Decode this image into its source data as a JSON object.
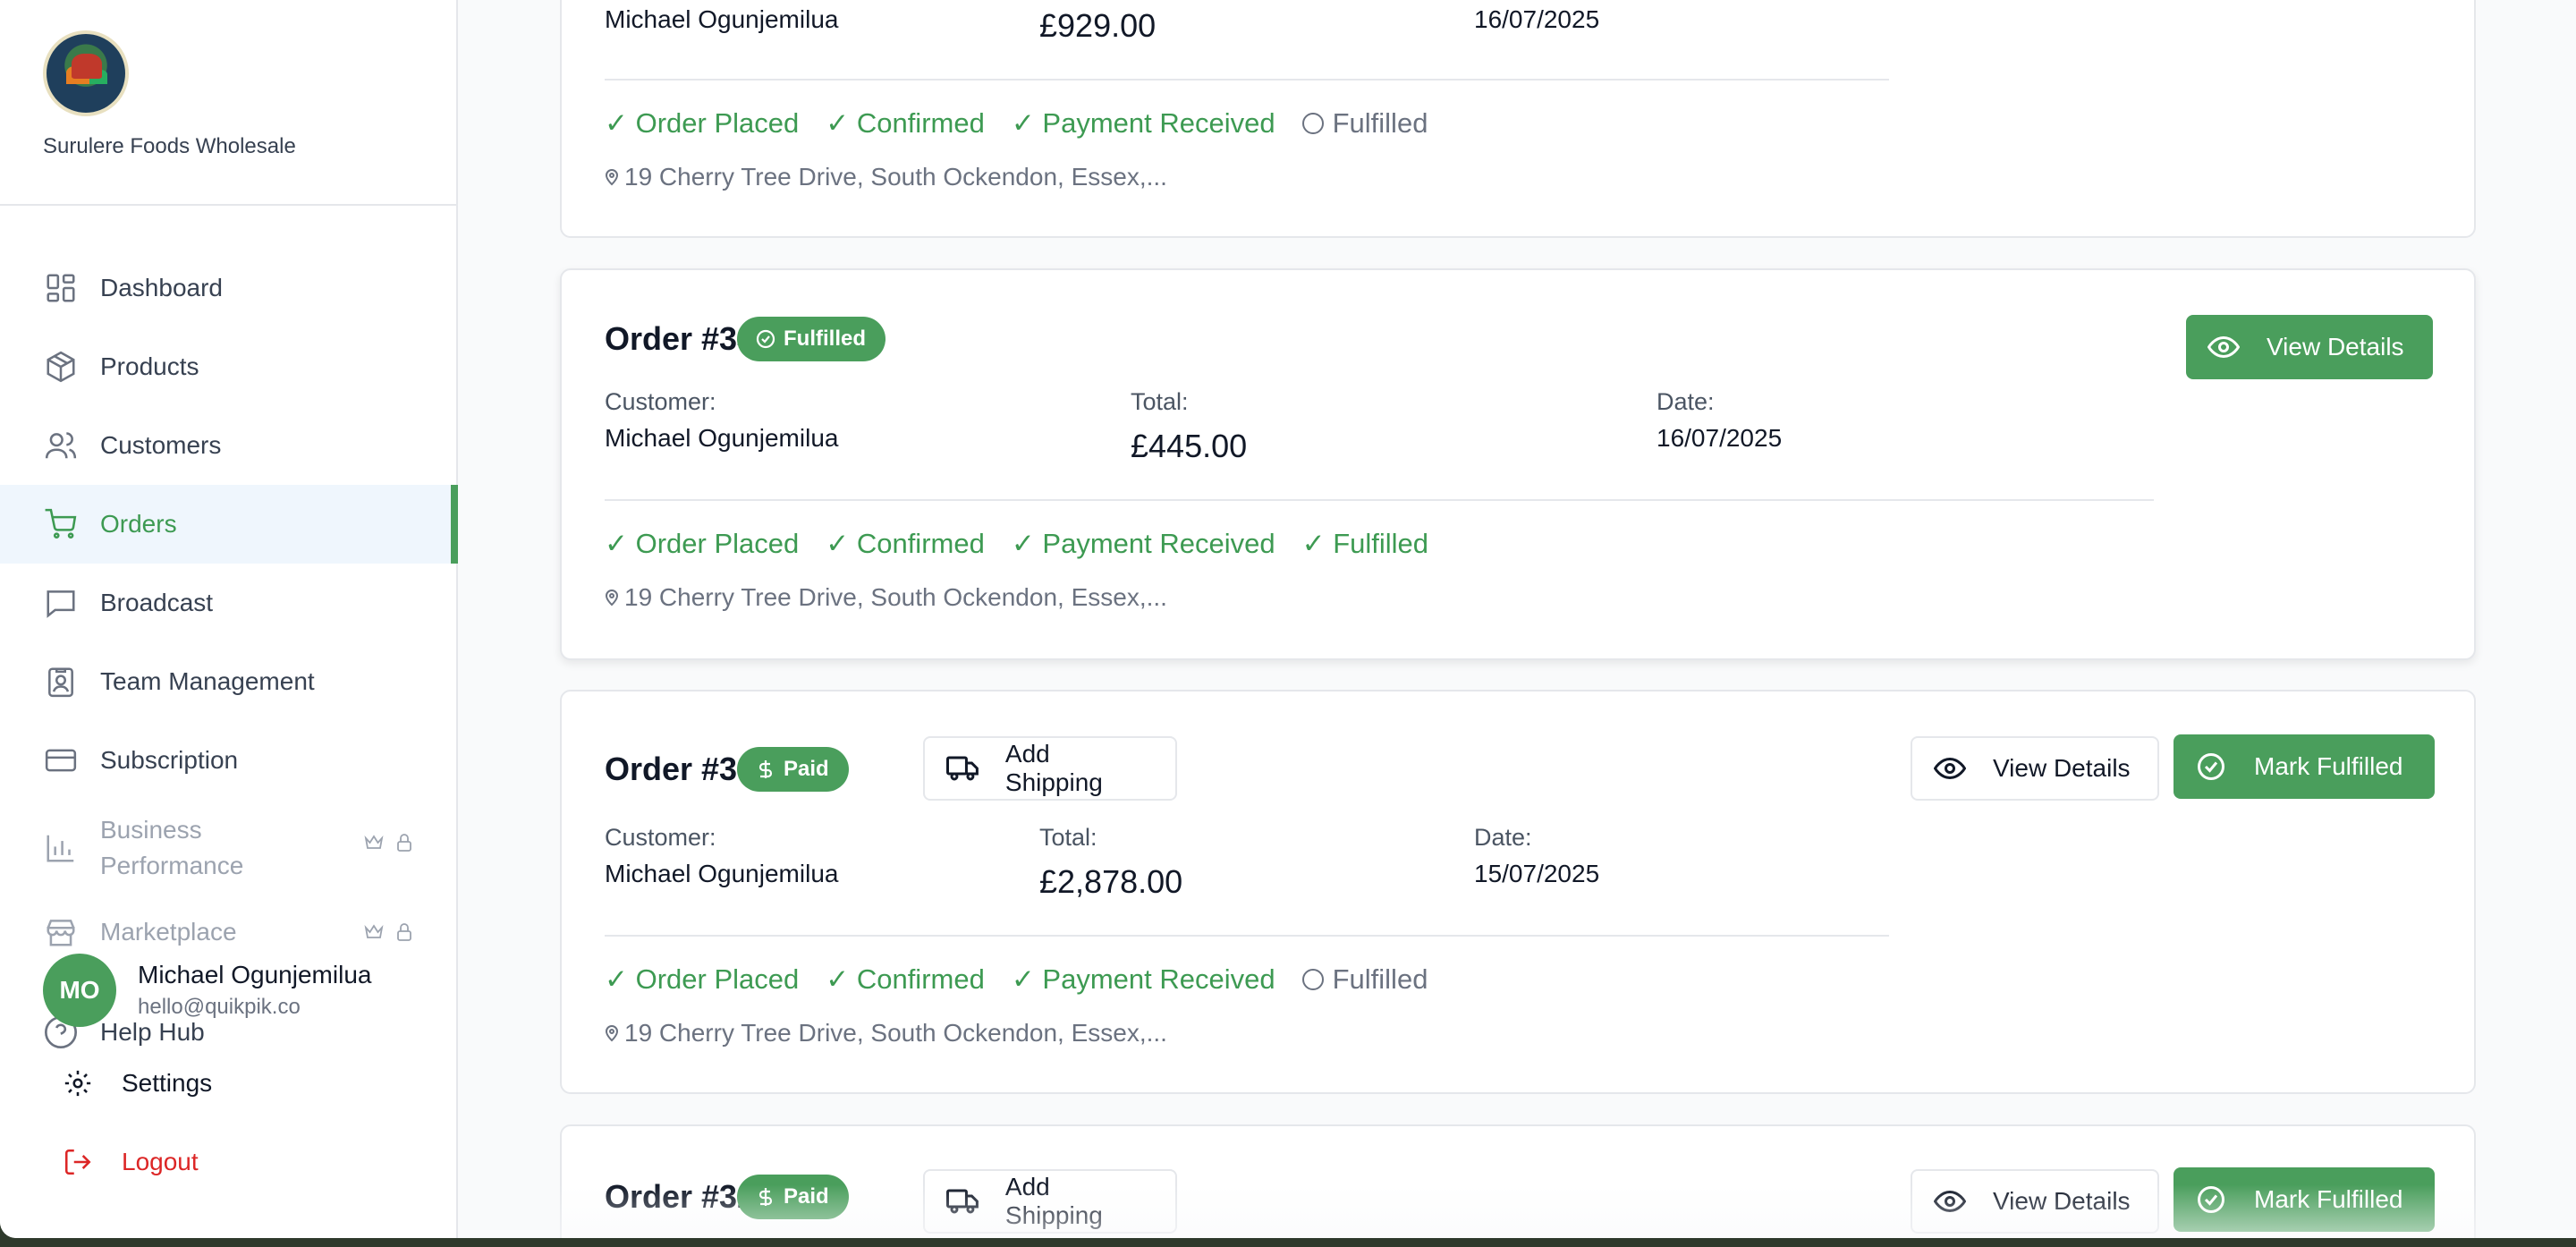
{
  "brand": {
    "name": "Surulere Foods Wholesale",
    "logo_icon": "store-logo"
  },
  "sidebar": {
    "items": [
      {
        "label": "Dashboard",
        "icon": "dashboard-icon"
      },
      {
        "label": "Products",
        "icon": "package-icon"
      },
      {
        "label": "Customers",
        "icon": "users-icon"
      },
      {
        "label": "Orders",
        "icon": "cart-icon",
        "active": true
      },
      {
        "label": "Broadcast",
        "icon": "message-icon"
      },
      {
        "label": "Team Management",
        "icon": "id-badge-icon"
      },
      {
        "label": "Subscription",
        "icon": "credit-card-icon"
      },
      {
        "label": "Business Performance",
        "icon": "bar-chart-icon",
        "locked": true
      },
      {
        "label": "Marketplace",
        "icon": "store-icon",
        "locked": true
      },
      {
        "label": "Help Hub",
        "icon": "help-circle-icon"
      }
    ],
    "user": {
      "initials": "MO",
      "name": "Michael Ogunjemilua",
      "email": "hello@quikpik.co"
    },
    "settings_label": "Settings",
    "logout_label": "Logout"
  },
  "labels": {
    "customer": "Customer:",
    "total": "Total:",
    "date": "Date:",
    "view_details": "View Details",
    "add_shipping": "Add Shipping",
    "mark_fulfilled": "Mark Fulfilled"
  },
  "orders": [
    {
      "customer": "Michael Ogunjemilua",
      "total": "£929.00",
      "date": "16/07/2025",
      "steps": [
        "✓ Order Placed",
        "✓ Confirmed",
        "✓ Payment Received",
        "Fulfilled"
      ],
      "address": "19 Cherry Tree Drive, South Ockendon, Essex,..."
    },
    {
      "title": "Order #34",
      "status": "Fulfilled",
      "customer": "Michael Ogunjemilua",
      "total": "£445.00",
      "date": "16/07/2025",
      "steps": [
        "✓ Order Placed",
        "✓ Confirmed",
        "✓ Payment Received",
        "✓ Fulfilled"
      ],
      "address": "19 Cherry Tree Drive, South Ockendon, Essex,..."
    },
    {
      "title": "Order #33",
      "status": "Paid",
      "customer": "Michael Ogunjemilua",
      "total": "£2,878.00",
      "date": "15/07/2025",
      "steps": [
        "✓ Order Placed",
        "✓ Confirmed",
        "✓ Payment Received",
        "Fulfilled"
      ],
      "address": "19 Cherry Tree Drive, South Ockendon, Essex,..."
    },
    {
      "title": "Order #32",
      "status": "Paid"
    }
  ],
  "colors": {
    "accent": "#4a9e5c",
    "danger": "#dc2626",
    "active_bg": "#eff6fd"
  }
}
